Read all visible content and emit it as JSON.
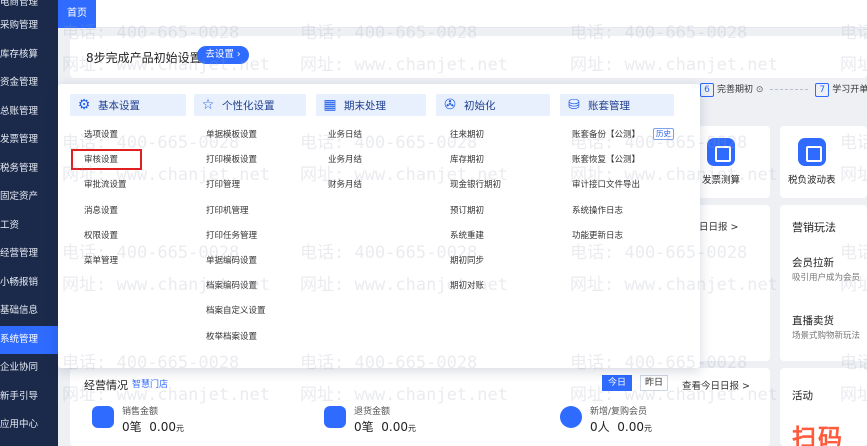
{
  "sidebar": {
    "items": [
      "电商管理",
      "采购管理",
      "库存核算",
      "资金管理",
      "总账管理",
      "发票管理",
      "税务管理",
      "固定资产",
      "工资",
      "经营管理",
      "小畅报销",
      "基础信息",
      "系统管理",
      "企业协同",
      "新手引导",
      "应用中心"
    ],
    "active_index": 12
  },
  "tabs": {
    "home": "首页"
  },
  "setup": {
    "title": "8步完成产品初始设置",
    "button": "去设置 ›"
  },
  "steps": [
    {
      "num": "6",
      "label": "完善期初"
    },
    {
      "num": "7",
      "label": "学习开单"
    }
  ],
  "tools": [
    {
      "label": "发票测算",
      "icon": "invoice-icon"
    },
    {
      "label": "税负波动表",
      "icon": "tax-chart-icon"
    }
  ],
  "daily_report_link": "看今日日报 >",
  "marketing": {
    "title": "营销玩法",
    "items": [
      {
        "title": "会员拉新",
        "sub": "吸引用户成为会员"
      },
      {
        "title": "直播卖货",
        "sub": "场景式购物新玩法"
      }
    ]
  },
  "business": {
    "title": "经营情况",
    "badge": "智慧门店",
    "today": "今日",
    "yesterday": "昨日",
    "report_link": "查看今日日报 >",
    "metrics": [
      {
        "label": "销售金额",
        "count": "0笔",
        "amount": "0.00",
        "unit": "元"
      },
      {
        "label": "退货金额",
        "count": "0笔",
        "amount": "0.00",
        "unit": "元"
      },
      {
        "label": "新增/复购会员",
        "count": "0人",
        "amount": "0.00",
        "unit": "元"
      }
    ]
  },
  "activity": {
    "title": "活动",
    "hero": "扫码"
  },
  "mega_menu": {
    "columns": [
      {
        "title": "基本设置",
        "icon": "gear-icon",
        "items": [
          "选项设置",
          "审核设置",
          "审批流设置",
          "消息设置",
          "权限设置",
          "菜单管理"
        ]
      },
      {
        "title": "个性化设置",
        "icon": "star-icon",
        "items": [
          "单据模板设置",
          "打印模板设置",
          "打印管理",
          "打印机管理",
          "打印任务管理",
          "单据编码设置",
          "档案编码设置",
          "档案自定义设置",
          "枚举档案设置"
        ]
      },
      {
        "title": "期末处理",
        "icon": "calendar-icon",
        "items": [
          "业务日结",
          "业务月结",
          "财务月结"
        ]
      },
      {
        "title": "初始化",
        "icon": "wrench-icon",
        "items": [
          "往来期初",
          "库存期初",
          "现金银行期初",
          "预订期初",
          "系统重建",
          "期初同步",
          "期初对账"
        ]
      },
      {
        "title": "账套管理",
        "icon": "database-icon",
        "items": [
          "账套备份【公测】",
          "账套恢复【公测】",
          "审计接口文件导出",
          "系统操作日志",
          "功能更新日志"
        ],
        "history_tag": "历史"
      }
    ],
    "highlighted_item": "选项设置"
  },
  "watermark": {
    "phone": "电话: 400-665-0028",
    "site": "网址: www.chanjet.net"
  }
}
